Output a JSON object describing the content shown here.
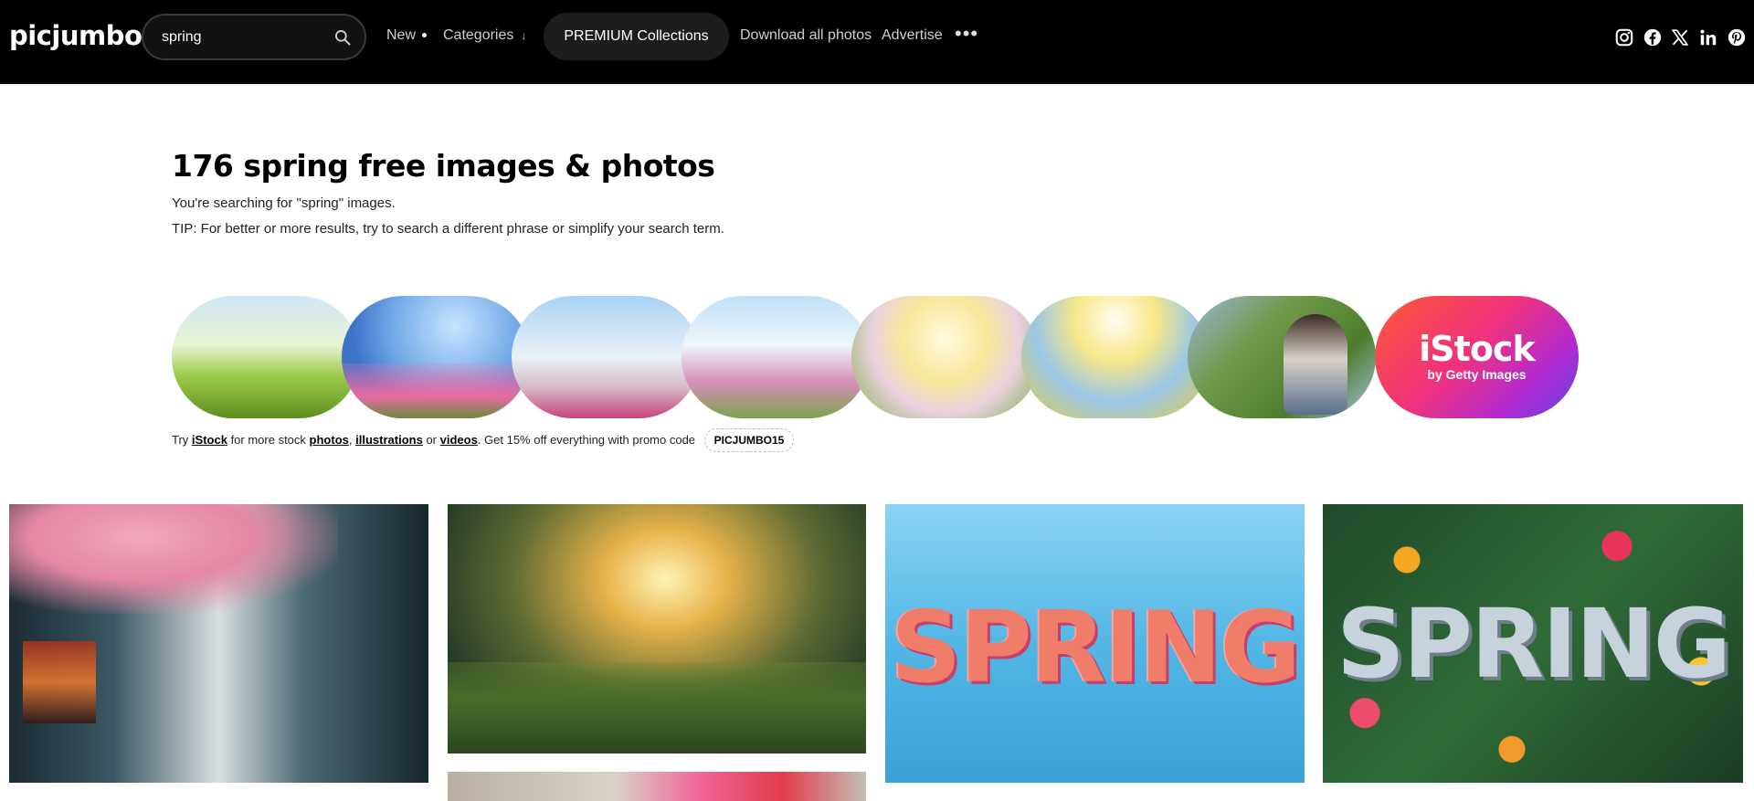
{
  "header": {
    "logo": "picjumbo",
    "search": {
      "value": "spring",
      "icon": "search-icon"
    },
    "nav": {
      "new": "New",
      "categories": "Categories",
      "categories_arrow": "↓",
      "premium": "PREMIUM Collections",
      "download_all": "Download all photos",
      "advertise": "Advertise",
      "more": "•••"
    },
    "social": [
      "instagram-icon",
      "facebook-icon",
      "x-icon",
      "linkedin-icon",
      "pinterest-icon"
    ]
  },
  "main": {
    "title": "176 spring free images & photos",
    "searching_note": "You're searching for \"spring\" images.",
    "tip": "TIP: For better or more results, try to search a different phrase or simplify your search term."
  },
  "istock": {
    "brand": "iStock",
    "tagline": "by Getty Images",
    "promo": {
      "try": "Try",
      "brand": "iStock",
      "for_more": "for more stock",
      "photos": "photos",
      "comma": ",",
      "illustrations": "illustrations",
      "or": "or",
      "videos": "videos",
      "rest": ". Get 15% off everything with promo code",
      "code": "PICJUMBO15"
    }
  },
  "gallery": {
    "tile3_text": "SPRING",
    "tile4_text": "SPRING"
  },
  "colors": {
    "header_bg": "#000000",
    "premium_bg": "#1d1d1d",
    "istock_gradient": [
      "#ff5a36",
      "#f0327c",
      "#b32ad0",
      "#5a44e8"
    ]
  }
}
